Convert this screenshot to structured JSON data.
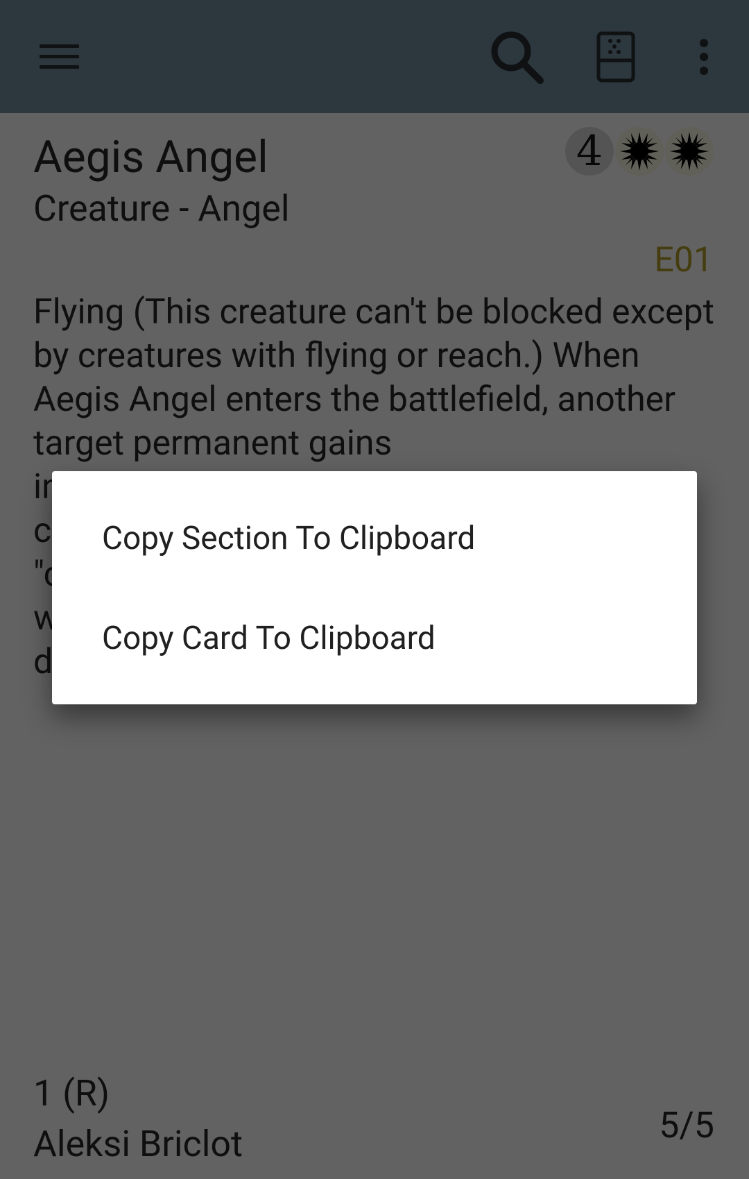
{
  "toolbar": {
    "menu_icon": "hamburger-menu-icon",
    "search_icon": "search-icon",
    "card_icon": "card-view-icon",
    "more_icon": "more-vertical-icon",
    "color": "#5a6e7c"
  },
  "card": {
    "name": "Aegis Angel",
    "mana_cost": {
      "generic": "4",
      "colored": [
        "white-sun-mana-icon",
        "white-sun-mana-icon"
      ]
    },
    "type_line": "Creature - Angel",
    "set_code": "E01",
    "oracle_visible": "Flying (This creature can't be blocked except by creatures with flying or reach.) When Aegis Angel enters the battlefield, another target permanent gains",
    "oracle_obscured_fragments": [
      "in",
      "c",
      "\"c",
      "w",
      "d"
    ],
    "rarity_line": "1 (R)",
    "artist": "Aleksi Briclot",
    "power_toughness": "5/5"
  },
  "dialog": {
    "items": [
      {
        "label": "Copy Section To Clipboard"
      },
      {
        "label": "Copy Card To Clipboard"
      }
    ]
  }
}
